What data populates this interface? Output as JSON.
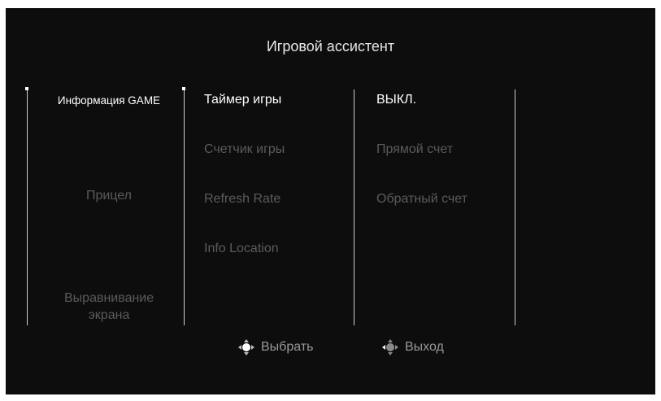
{
  "title": "Игровой ассистент",
  "menu": {
    "main": [
      {
        "label": "Информация GAME",
        "active": true
      },
      {
        "label": "Прицел",
        "active": false
      },
      {
        "label": "Выравнивание экрана",
        "active": false
      }
    ],
    "sub": [
      {
        "label": "Таймер игры",
        "active": true
      },
      {
        "label": "Счетчик игры",
        "active": false
      },
      {
        "label": "Refresh Rate",
        "active": false
      },
      {
        "label": "Info Location",
        "active": false
      }
    ],
    "options": [
      {
        "label": "ВЫКЛ.",
        "active": true
      },
      {
        "label": "Прямой счет",
        "active": false
      },
      {
        "label": "Обратный счет",
        "active": false
      }
    ]
  },
  "hints": {
    "select_label": "Выбрать",
    "exit_label": "Выход",
    "select_icon": "joystick-icon",
    "exit_icon": "joystick-left-icon"
  },
  "colors": {
    "background": "#0d0d0d",
    "active_text": "#ffffff",
    "inactive_text": "#5b5b5b"
  }
}
